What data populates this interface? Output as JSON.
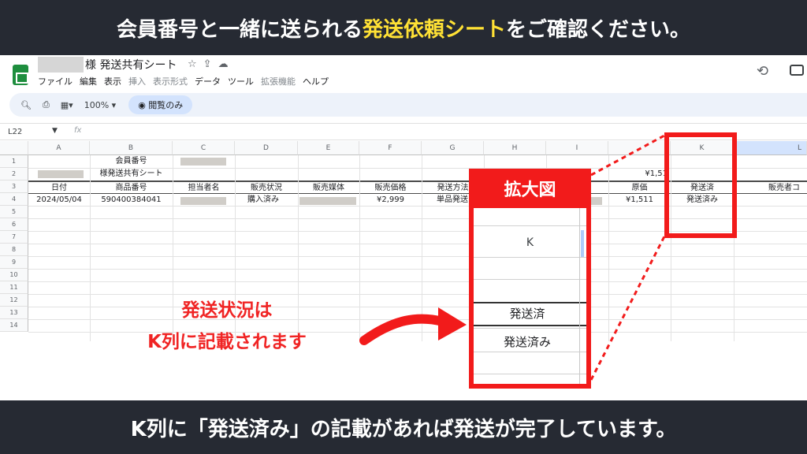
{
  "banner_top": {
    "text_before": "会員番号と一緒に送られる",
    "highlight": "発送依頼シート",
    "text_after": "をご確認ください。"
  },
  "banner_bottom": {
    "text": "K列に「発送済み」の記載があれば発送が完了しています。"
  },
  "sheet": {
    "title": "様 発送共有シート",
    "menu": [
      "ファイル",
      "編集",
      "表示",
      "挿入",
      "表示形式",
      "データ",
      "ツール",
      "拡張機能",
      "ヘルプ"
    ],
    "menu_dim": [
      false,
      false,
      false,
      true,
      true,
      false,
      false,
      true,
      false
    ],
    "toolbar": {
      "zoom": "100%",
      "view_only": "閲覧のみ"
    },
    "name_box": "L22",
    "fx": "fx",
    "columns": [
      "A",
      "B",
      "C",
      "D",
      "E",
      "F",
      "G",
      "H",
      "I",
      "",
      "K",
      "L"
    ],
    "rows": [
      "1",
      "2",
      "3",
      "4",
      "5",
      "6",
      "7",
      "8",
      "9",
      "10",
      "11",
      "12",
      "13",
      "14"
    ],
    "row1": {
      "b": "会員番号"
    },
    "row2": {
      "b": "様発送共有シート",
      "j": "¥1,51"
    },
    "headers": [
      "日付",
      "商品番号",
      "担当者名",
      "販売状況",
      "販売媒体",
      "販売価格",
      "発送方法",
      "",
      "",
      "原価",
      "発送済",
      "販売者コ"
    ],
    "row4": [
      "2024/05/04",
      "590400384041",
      "",
      "購入済み",
      "",
      "¥2,999",
      "単品発送",
      "",
      "",
      "¥1,511",
      "発送済み",
      ""
    ]
  },
  "zoom": {
    "title": "拡大図",
    "col_label": "K",
    "header": "発送済",
    "value": "発送済み"
  },
  "annotation": {
    "line1": "発送状況は",
    "line2": "K列に記載されます"
  },
  "colors": {
    "accent_red": "#f21b1b",
    "banner_bg": "#262a33",
    "highlight_yellow": "#ffe135"
  }
}
